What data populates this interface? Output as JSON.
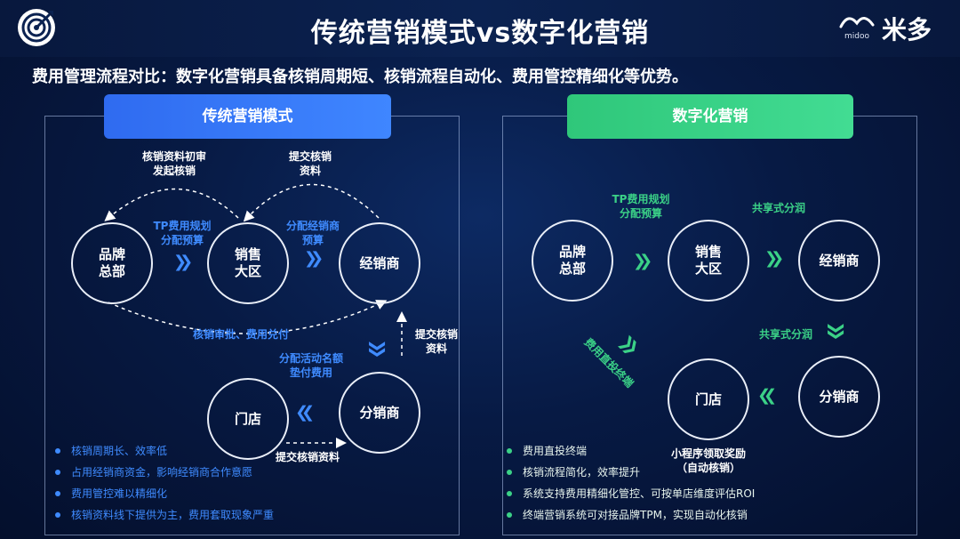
{
  "header": {
    "title": "传统营销模式vs数字化营销",
    "brand_name": "米多",
    "brand_small": "midoo"
  },
  "subtitle": "费用管理流程对比：数字化营销具备核销周期短、核销流程自动化、费用管控精细化等优势。",
  "traditional": {
    "heading": "传统营销模式",
    "nodes": {
      "brand_hq": "品牌\n总部",
      "sales_region": "销售\n大区",
      "distributor": "经销商",
      "sub_distributor": "分销商",
      "store": "门店"
    },
    "labels": {
      "initial_review": "核销资料初审\n发起核销",
      "submit_materials_top": "提交核销\n资料",
      "tp_budget": "TP费用规划\n分配预算",
      "dist_budget": "分配经销商\n预算",
      "approval_payment": "核销审批、费用兑付",
      "submit_materials_right": "提交核销\n资料",
      "activity_quota": "分配活动名额\n垫付费用",
      "submit_materials_bottom": "提交核销资料"
    },
    "bullets": [
      "核销周期长、效率低",
      "占用经销商资金，影响经销商合作意愿",
      "费用管控难以精细化",
      "核销资料线下提供为主，费用套取现象严重"
    ]
  },
  "digital": {
    "heading": "数字化营销",
    "nodes": {
      "brand_hq": "品牌\n总部",
      "sales_region": "销售\n大区",
      "distributor": "经销商",
      "sub_distributor": "分销商",
      "store": "门店"
    },
    "labels": {
      "tp_budget": "TP费用规划\n分配预算",
      "shared_split_top": "共享式分润",
      "shared_split_right": "共享式分润",
      "direct_terminal": "费用直投终端",
      "mini_program": "小程序领取奖励\n（自动核销）"
    },
    "bullets": [
      "费用直投终端",
      "核销流程简化，效率提升",
      "系统支持费用精细化管控、可按单店维度评估ROI",
      "终端营销系统可对接品牌TPM，实现自动化核销"
    ]
  },
  "colors": {
    "blue_accent": "#3f8bff",
    "green_accent": "#3bd187",
    "background": "#071a44"
  },
  "icons": {
    "logo": "target-icon",
    "arrow_chevron": "double-chevron-icon"
  }
}
